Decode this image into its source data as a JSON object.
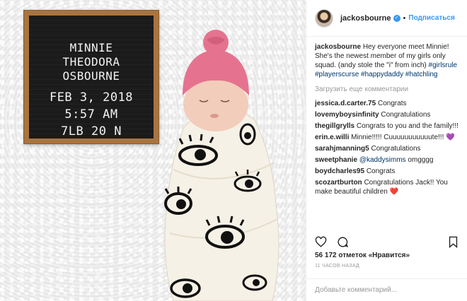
{
  "photo": {
    "board_lines": [
      "MINNIE",
      "THEODORA",
      "OSBOURNE",
      "FEB 3, 2018",
      "5:57 AM",
      "7LB 20 N"
    ]
  },
  "header": {
    "username": "jackosbourne",
    "verified_icon": "verified-badge-icon",
    "separator": "•",
    "follow_label": "Подписаться"
  },
  "caption": {
    "username": "jackosbourne",
    "text": "Hey everyone meet Minnie! She's the newest member of my girls only squad. (andy stole the \"i\" from inch)",
    "hashtags": [
      "#girlsrule",
      "#playerscurse",
      "#happydaddy",
      "#hatchling"
    ]
  },
  "load_more_label": "Загрузить еще комментарии",
  "comments": [
    {
      "user": "jessica.d.carter.75",
      "text": "Congrats"
    },
    {
      "user": "lovemyboysinfinity",
      "text": "Congratulations"
    },
    {
      "user": "thegillgrylls",
      "text": "Congrats to you and the family!!!"
    },
    {
      "user": "erin.e.willi",
      "text": "Minnie!!!!! Cuuuuuuuuuuute!!!",
      "emoji": "💜"
    },
    {
      "user": "sarahjmanning5",
      "text": "Congratulations"
    },
    {
      "user": "sweetphanie",
      "mention": "@kaddysimms",
      "text": "omgggg"
    },
    {
      "user": "boydcharles95",
      "text": "Congrats"
    },
    {
      "user": "scozartburton",
      "text": "Congratulations Jack!! You make beautiful children",
      "emoji": "❤️"
    }
  ],
  "actions": {
    "like_icon": "heart-icon",
    "comment_icon": "comment-icon",
    "save_icon": "bookmark-icon"
  },
  "likes_text": "56 172 отметок «Нравится»",
  "time_text": "11 ЧАСОВ НАЗАД",
  "add_comment_placeholder": "Добавьте комментарий...",
  "colors": {
    "accent": "#3897f0",
    "hashtag": "#003569",
    "muted": "#999999",
    "hat_pink": "#e5738f"
  }
}
